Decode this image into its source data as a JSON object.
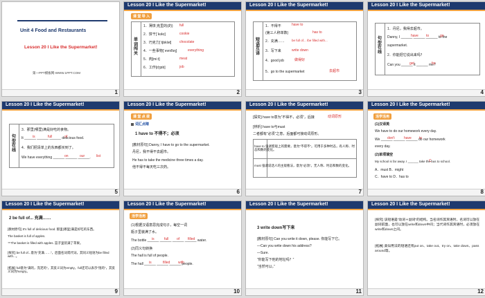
{
  "slides": [
    {
      "num": "1",
      "unit": "Unit 4  Food and Restaurants",
      "lesson": "Lesson 20    I Like the Supermarket!",
      "footer": "第一PPT模板网-WWW.1PPT.COM"
    },
    {
      "num": "2",
      "title": "Lesson 20    I Like the Supermarket!",
      "tag": "课 堂 导 入",
      "label": "单词闯关",
      "lines": [
        "1．薄饼;克里的(的)",
        "2．饼干[ˈkʊkɪ]",
        "3．巧克力[ˈtʃɒklət]",
        "4．一些事物[ˈevrɪθɪŋ]",
        "5．肉[miːt]",
        "6．工作[dʒɒb]"
      ],
      "answers": [
        "full",
        "cookie",
        "chocolate",
        "everything",
        "meat",
        "job"
      ]
    },
    {
      "num": "3",
      "title": "Lesson 20    I Like the Supermarket!",
      "label": "短语互译",
      "lines": [
        "1．不得不",
        "(第三人称单数)",
        "2．充满……",
        "3．写下来",
        "4．good job",
        "5．go to the supermarket"
      ],
      "answers": [
        "have to",
        "has to",
        "be full of... /be filled with...",
        "write down",
        "做得好",
        "去超市"
      ]
    },
    {
      "num": "4",
      "title": "Lesson 20    I Like the Supermarket!",
      "label": "句型在线",
      "lines": [
        "1．丹尼，我得去超市。",
        "Danny, I ______ ______ ______ to the",
        "supermarket.",
        "2．你能把它说出来吗？",
        "Can you ______ it ______ me?"
      ],
      "answers": [
        "have",
        "to",
        "go",
        "get",
        "for"
      ]
    },
    {
      "num": "5",
      "title": "Lesson 20    I Like the Supermarket!",
      "label": "句型在线",
      "lines": [
        "3．那里(哪里)满是好吃的食物。",
        "It ______ ______ ______ delicious food.",
        "4．我们把清单上的东西都买到了。",
        "We have everything ______ ______ ______."
      ],
      "answers": [
        "is",
        "full",
        "of",
        "on",
        "our",
        "list"
      ]
    },
    {
      "num": "6",
      "title": "Lesson 20    I Like the Supermarket!",
      "tag": "课 堂 点 拨",
      "sub": "词汇点睛",
      "lines": [
        "1    have  to   不得不；必须",
        "[教材原句] Danny, I have to go to the supermarket.",
        "丹尼，我不得不去超市。",
        "He has to take the medicine three times a day.",
        "他不得不每天吃三次药。"
      ]
    },
    {
      "num": "7",
      "title": "Lesson 20    I Like the Supermarket!",
      "lines": [
        "[探究] have to意为“不得不，必须”，后接",
        "[辨析] have to与must",
        "二者都有“必须”之意，后面都可接动词原形。",
        "have to  强调客观上的需要，意为“不得不”。可用于多种时态，有人称、时态和数的变化。",
        "must  强调说话人的主观看法，意为“必须”。无人称、时态和数的变化。"
      ],
      "answers": [
        "动词原形"
      ]
    },
    {
      "num": "8",
      "title": "Lesson 20    I Like the Supermarket!",
      "tag": "活学活用",
      "lines": [
        "(1)汉译英",
        "We have to do our homework every day.",
        "We ______ ______ ______ do our homework",
        "every day.",
        "(2)单项填空",
        "My school is far away. I ______ take the bus to school.",
        "A．must         B．might",
        "C．have to     D．has to"
      ],
      "answers": [
        "don't",
        "have",
        "to",
        "C"
      ]
    },
    {
      "num": "9",
      "title": "Lesson 20    I Like the Supermarket!",
      "lines": [
        "2    be full of... 充满……",
        "[教材原句] It's full of delicious food. 那里(哪里)满是好吃的东西。",
        "The basket is full of apples.",
        "＝The basket is filled with apples. 篮子里装满了苹果。",
        "[探究] be full of...意为“充满……”，后面名词或代词，其同义短语为be filled with...。",
        "[拓展] full意为“满的，充足的”，其反义词为empty，full还可以表示“饱的”，其反义词为hungry。"
      ]
    },
    {
      "num": "10",
      "title": "Lesson 20    I Like the Supermarket!",
      "tag": "活学活用",
      "lines": [
        "(1)根据汉语意思完成句子，每空一词",
        "瓶子里装满了水。",
        "The bottle ______ ______ ______ ______ water.",
        "(2)同义句转换",
        "The hall is full of people.",
        "The hall ______ ______ ______ people."
      ],
      "answers": [
        "is",
        "full",
        "of",
        "filled",
        "with",
        "is",
        "filled",
        "with"
      ]
    },
    {
      "num": "11",
      "title": "Lesson 20    I Like the Supermarket!",
      "lines": [
        "3    write down写下来",
        "[教材原句] Can you write it down, please. 你能写下它。",
        "—Can you write down his address?",
        "—Sure.",
        "“你能写下他的地址吗？”",
        "“当然可以。”"
      ]
    },
    {
      "num": "12",
      "title": "Lesson 20    I Like the Supermarket!",
      "lines": [
        "[探究] 该短语是“动词＋副词”的结构。当名词作其宾语时，名词可以放在副词前面，也可以放在write和down中间；当代词作其宾语时，必须放在write和down之间。",
        "[拓展] 类似用法的短语还有put on、take out、try on、take down、pass around等。"
      ]
    }
  ]
}
